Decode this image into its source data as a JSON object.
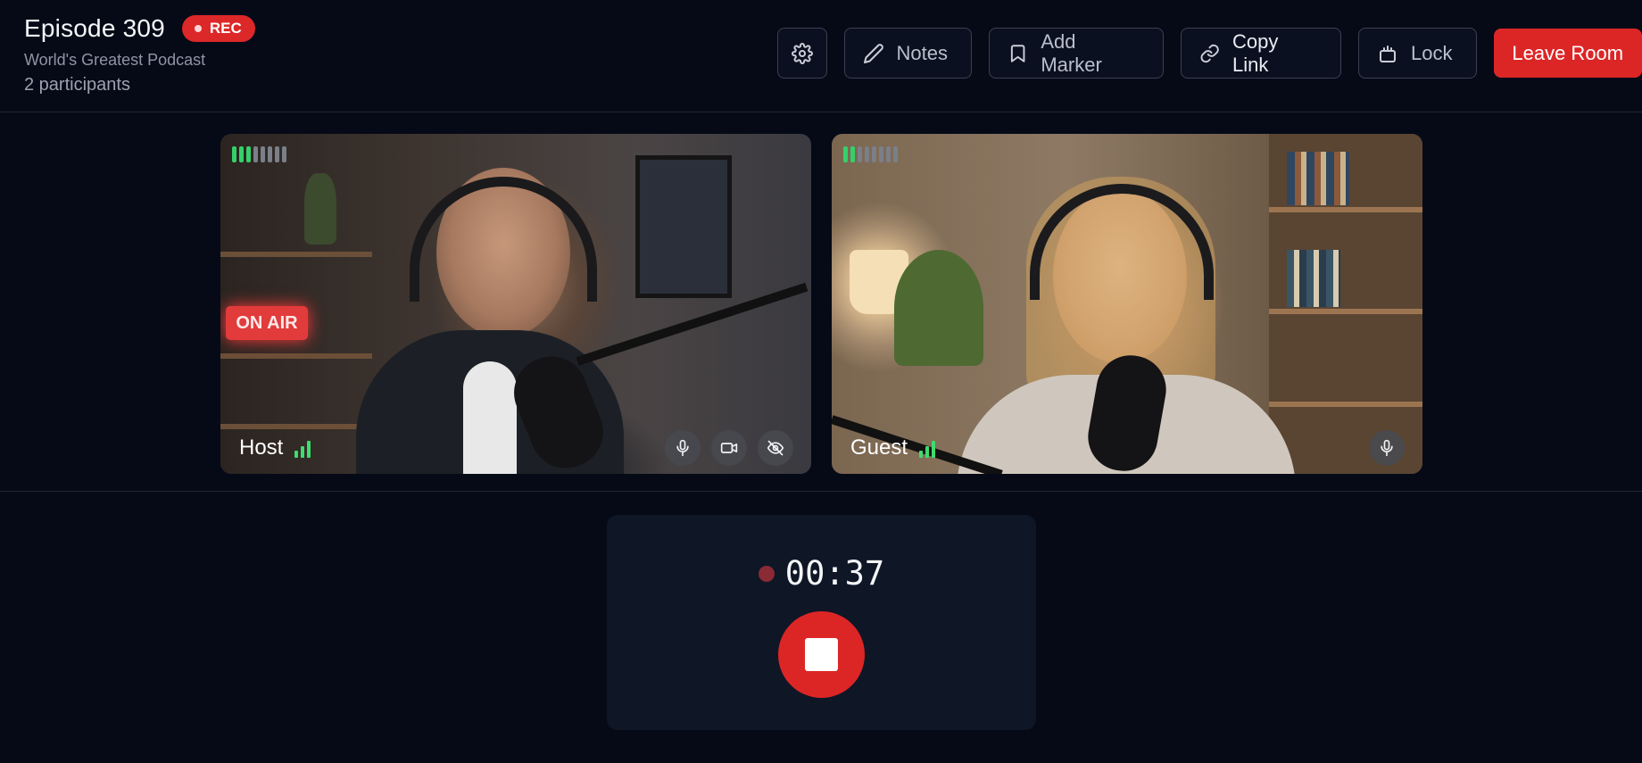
{
  "header": {
    "title": "Episode 309",
    "rec_badge": "REC",
    "show_name": "World's Greatest Podcast",
    "participants": "2 participants"
  },
  "toolbar": {
    "settings_icon": "gear-icon",
    "notes_label": "Notes",
    "add_marker_label": "Add Marker",
    "copy_link_label": "Copy Link",
    "lock_label": "Lock",
    "leave_label": "Leave Room"
  },
  "tiles": [
    {
      "name": "Host",
      "level_segments_on": 3,
      "level_segments_total": 8,
      "signal_bars": 3,
      "sign_text": "ON AIR",
      "controls": [
        "microphone-icon",
        "video-camera-icon",
        "eye-off-icon"
      ]
    },
    {
      "name": "Guest",
      "level_segments_on": 2,
      "level_segments_total": 8,
      "signal_bars": 3,
      "controls": [
        "microphone-icon"
      ]
    }
  ],
  "recorder": {
    "elapsed": "00:37",
    "stop_icon": "stop-icon"
  },
  "colors": {
    "background": "#060a17",
    "accent_red": "#dc2626",
    "level_green": "#34d06a",
    "panel": "#0f1626"
  }
}
